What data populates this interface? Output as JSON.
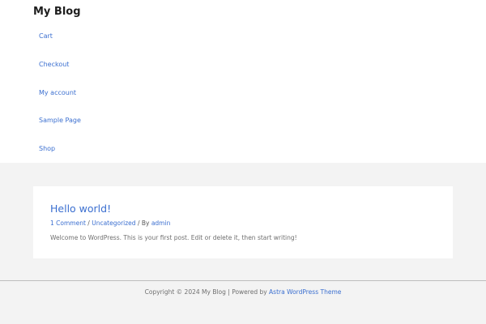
{
  "site": {
    "title": "My Blog"
  },
  "nav": {
    "items": [
      {
        "label": "Cart"
      },
      {
        "label": "Checkout"
      },
      {
        "label": "My account"
      },
      {
        "label": "Sample Page"
      },
      {
        "label": "Shop"
      }
    ]
  },
  "post": {
    "title": "Hello world!",
    "comments": "1 Comment",
    "separator_1": " / ",
    "category": "Uncategorized",
    "by_text": " / By ",
    "author": "admin",
    "excerpt": "Welcome to WordPress. This is your first post. Edit or delete it, then start writing!"
  },
  "footer": {
    "copyright": "Copyright © 2024 My Blog | Powered by ",
    "theme_link": "Astra WordPress Theme"
  },
  "colors": {
    "link": "#3b6fd0",
    "header_bg": "#ffffff",
    "page_bg": "#f3f3f3"
  }
}
